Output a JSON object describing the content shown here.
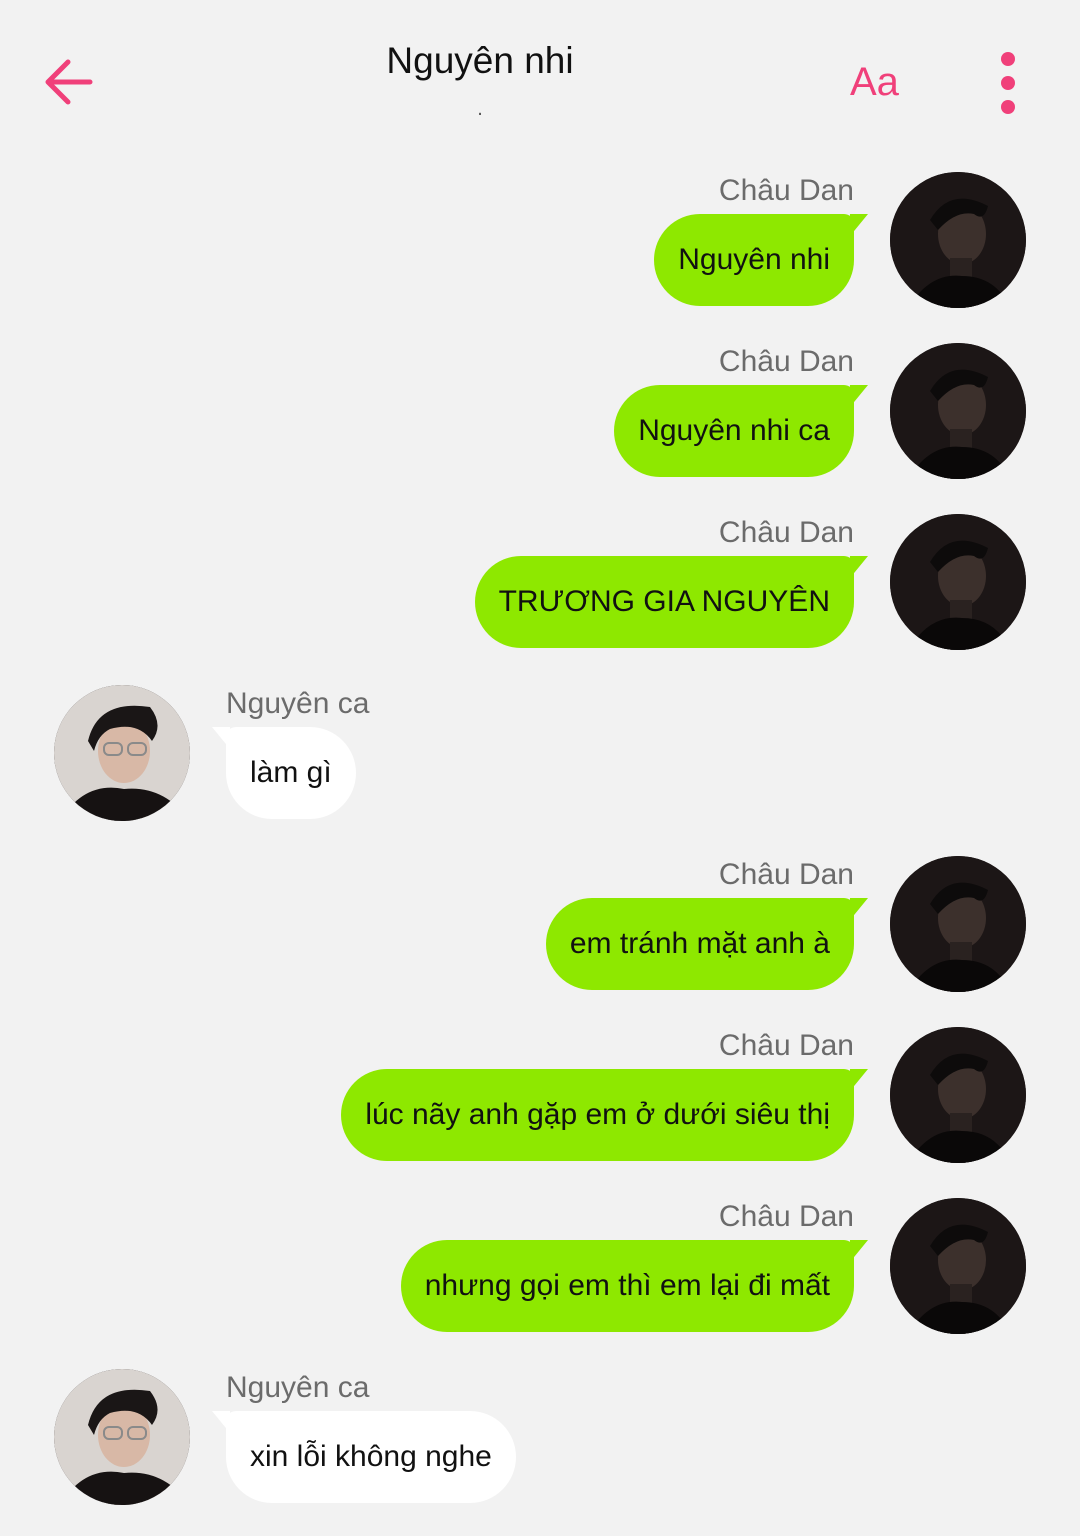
{
  "header": {
    "title": "Nguyên nhi",
    "subtitle": ".",
    "font_button_label": "Aa",
    "accent_color": "#f0407a",
    "back_icon": "arrow-left-icon",
    "more_icon": "more-vertical-icon"
  },
  "colors": {
    "outgoing_bubble": "#8ee800",
    "incoming_bubble": "#ffffff",
    "background": "#f2f2f2"
  },
  "messages": [
    {
      "sender": "Châu Dan",
      "text": "Nguyên nhi",
      "side": "right"
    },
    {
      "sender": "Châu Dan",
      "text": "Nguyên nhi ca",
      "side": "right"
    },
    {
      "sender": "Châu Dan",
      "text": "TRƯƠNG GIA NGUYÊN",
      "side": "right"
    },
    {
      "sender": "Nguyên ca",
      "text": "làm gì",
      "side": "left"
    },
    {
      "sender": "Châu Dan",
      "text": "em tránh mặt anh à",
      "side": "right"
    },
    {
      "sender": "Châu Dan",
      "text": "lúc nãy anh gặp em ở dưới siêu thị",
      "side": "right"
    },
    {
      "sender": "Châu Dan",
      "text": "nhưng gọi em thì em lại đi mất",
      "side": "right"
    },
    {
      "sender": "Nguyên ca",
      "text": "xin lỗi không nghe",
      "side": "left"
    }
  ]
}
